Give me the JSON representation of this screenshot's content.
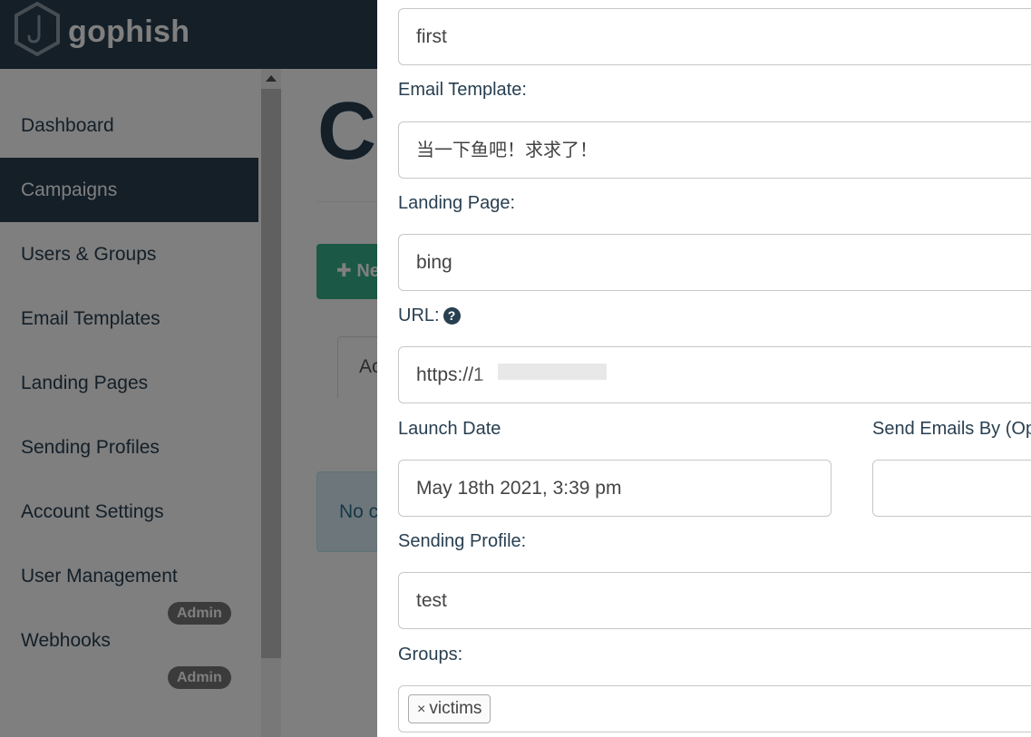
{
  "app": {
    "brand": "gophish"
  },
  "sidebar": {
    "items": [
      {
        "label": "Dashboard"
      },
      {
        "label": "Campaigns"
      },
      {
        "label": "Users & Groups"
      },
      {
        "label": "Email Templates"
      },
      {
        "label": "Landing Pages"
      },
      {
        "label": "Sending Profiles"
      },
      {
        "label": "Account Settings"
      },
      {
        "label": "User Management"
      },
      {
        "label": "Webhooks"
      }
    ],
    "admin_badge": "Admin"
  },
  "main": {
    "title": "Ca",
    "new_button_label": "New",
    "tab_label": "Ac",
    "alert_text": "No c"
  },
  "modal": {
    "name_value": "first",
    "email_template": {
      "label": "Email Template:",
      "value": "当一下鱼吧！求求了！"
    },
    "landing_page": {
      "label": "Landing Page:",
      "value": "bing"
    },
    "url": {
      "label": "URL:",
      "value": "https://1"
    },
    "launch_date": {
      "label": "Launch Date",
      "value": "May 18th 2021, 3:39 pm"
    },
    "send_by": {
      "label": "Send Emails By (Op",
      "value": ""
    },
    "sending_profile": {
      "label": "Sending Profile:",
      "value": "test"
    },
    "groups": {
      "label": "Groups:",
      "chips": [
        "victims"
      ],
      "chip_remove": "×"
    }
  },
  "colors": {
    "navbar": "#283f50",
    "accent_green": "#37b08a",
    "badge": "#777777"
  },
  "icons": [
    "hook-logo-icon",
    "plus-icon",
    "question-circle-icon",
    "remove-x-icon",
    "scroll-up-arrow-icon"
  ]
}
